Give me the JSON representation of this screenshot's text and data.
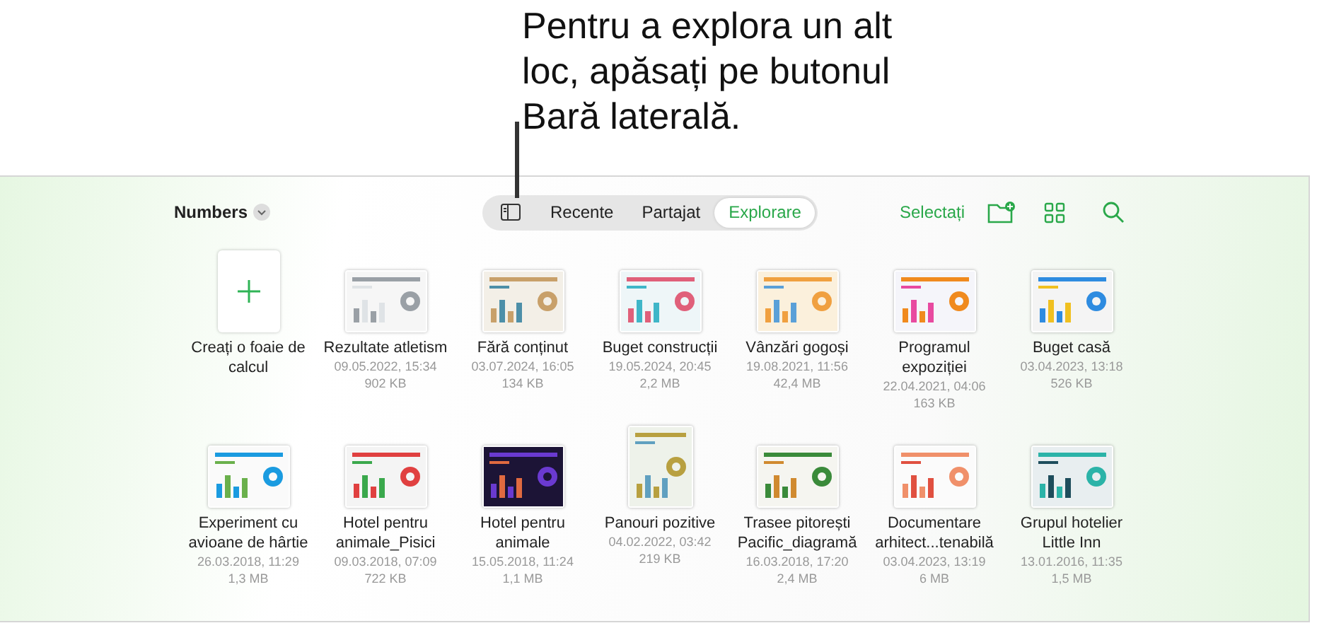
{
  "callout": "Pentru a explora un alt loc, apăsați pe butonul Bară laterală.",
  "toolbar": {
    "app_menu": "Numbers",
    "tabs": [
      {
        "label": "Recente",
        "selected": false
      },
      {
        "label": "Partajat",
        "selected": false
      },
      {
        "label": "Explorare",
        "selected": true
      }
    ],
    "select": "Selectați"
  },
  "files": [
    {
      "kind": "new",
      "name": "Creați o foaie de calcul"
    },
    {
      "kind": "landscape",
      "name": "Rezultate atletism",
      "date": "09.05.2022, 15:34",
      "size": "902 KB"
    },
    {
      "kind": "landscape",
      "name": "Fără conținut",
      "date": "03.07.2024, 16:05",
      "size": "134 KB"
    },
    {
      "kind": "landscape",
      "name": "Buget construcții",
      "date": "19.05.2024, 20:45",
      "size": "2,2 MB"
    },
    {
      "kind": "landscape",
      "name": "Vânzări gogoși",
      "date": "19.08.2021, 11:56",
      "size": "42,4 MB"
    },
    {
      "kind": "landscape",
      "name": "Programul expoziției",
      "date": "22.04.2021, 04:06",
      "size": "163 KB"
    },
    {
      "kind": "landscape",
      "name": "Buget casă",
      "date": "03.04.2023, 13:18",
      "size": "526 KB"
    },
    {
      "kind": "landscape",
      "name": "Experiment cu avioane de hârtie",
      "date": "26.03.2018, 11:29",
      "size": "1,3 MB"
    },
    {
      "kind": "landscape",
      "name": "Hotel pentru animale_Pisici",
      "date": "09.03.2018, 07:09",
      "size": "722 KB"
    },
    {
      "kind": "landscape",
      "name": "Hotel pentru animale",
      "date": "15.05.2018, 11:24",
      "size": "1,1 MB"
    },
    {
      "kind": "portrait",
      "name": "Panouri pozitive",
      "date": "04.02.2022, 03:42",
      "size": "219 KB"
    },
    {
      "kind": "landscape",
      "name": "Trasee pitorești Pacific_diagramă",
      "date": "16.03.2018, 17:20",
      "size": "2,4 MB"
    },
    {
      "kind": "landscape",
      "name": "Documentare arhitect...tenabilă",
      "date": "03.04.2023, 13:19",
      "size": "6 MB"
    },
    {
      "kind": "landscape",
      "name": "Grupul hotelier Little Inn",
      "date": "13.01.2016, 11:35",
      "size": "1,5 MB"
    }
  ]
}
